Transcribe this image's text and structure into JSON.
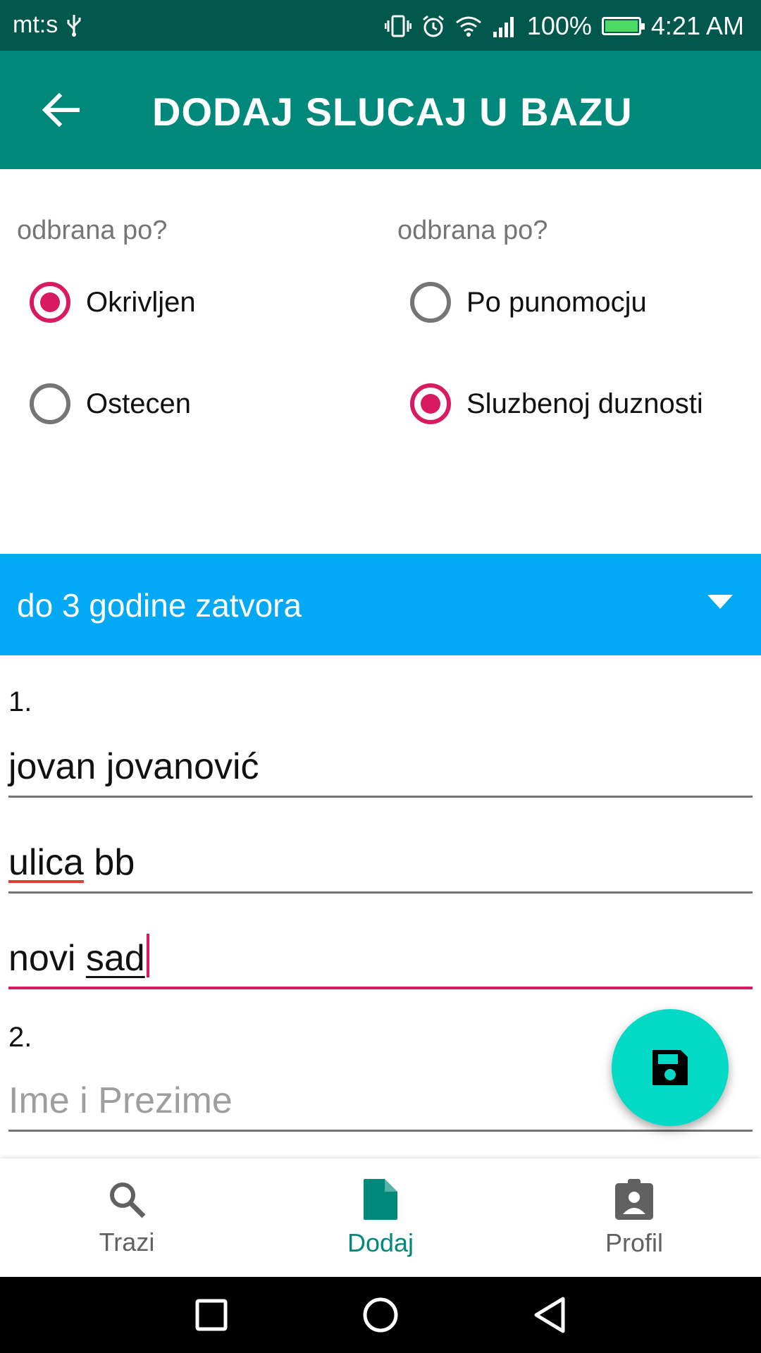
{
  "status_bar": {
    "carrier": "mt:s",
    "battery": "100%",
    "battery_level": 1.0,
    "time": "4:21 AM"
  },
  "app_bar": {
    "back_icon": "arrow-back-icon",
    "title": "DODAJ SLUCAJ U BAZU"
  },
  "radio_groups": [
    {
      "label": "odbrana po?",
      "options": [
        {
          "label": "Okrivljen",
          "checked": true
        },
        {
          "label": "Ostecen",
          "checked": false
        }
      ]
    },
    {
      "label": "odbrana po?",
      "options": [
        {
          "label": "Po punomocju",
          "checked": false
        },
        {
          "label": "Sluzbenoj duznosti",
          "checked": true
        }
      ]
    }
  ],
  "spinner": {
    "selected": "do 3 godine zatvora",
    "icon": "dropdown-arrow-icon"
  },
  "form": {
    "entries": [
      {
        "number": "1.",
        "name": "jovan jovanović",
        "address_word1": "ulica",
        "address_word2": "bb",
        "city_word1": "novi",
        "city_word2": "sad"
      },
      {
        "number": "2.",
        "name_placeholder": "Ime i Prezime"
      }
    ]
  },
  "fab": {
    "icon": "save-icon",
    "color": "#03dac5"
  },
  "bottom_nav": {
    "items": [
      {
        "label": "Trazi",
        "icon": "search-icon",
        "active": false
      },
      {
        "label": "Dodaj",
        "icon": "document-icon",
        "active": true
      },
      {
        "label": "Profil",
        "icon": "clipboard-profile-icon",
        "active": false
      }
    ]
  },
  "colors": {
    "status_bar": "#00574b",
    "app_bar": "#00897b",
    "accent": "#d81b60",
    "spinner": "#03a9f4"
  }
}
